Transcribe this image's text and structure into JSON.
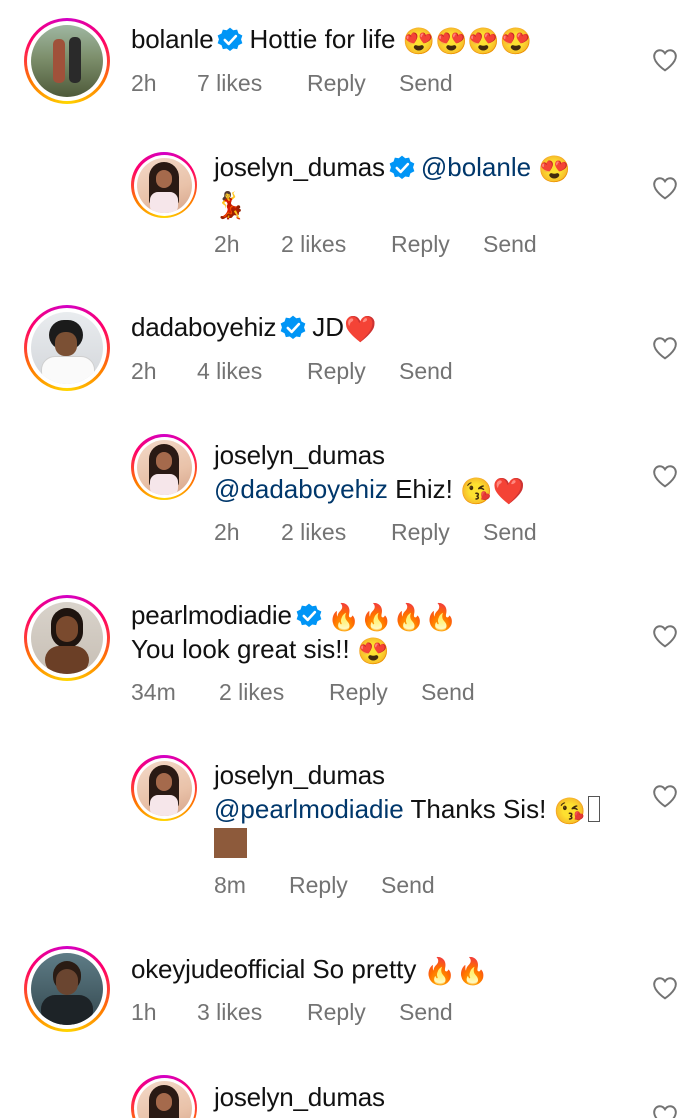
{
  "comments": [
    {
      "username": "bolanle",
      "verified": true,
      "text": "Hottie for life",
      "emoji": "😍😍😍😍",
      "time": "2h",
      "likes": "7 likes",
      "reply": "Reply",
      "send": "Send"
    },
    {
      "username": "joselyn_dumas",
      "verified": true,
      "mention": "@bolanle",
      "emoji": "😍",
      "emoji2": "💃",
      "time": "2h",
      "likes": "2 likes",
      "reply": "Reply",
      "send": "Send"
    },
    {
      "username": "dadaboyehiz",
      "verified": true,
      "text": "JD",
      "emoji": "❤️",
      "time": "2h",
      "likes": "4 likes",
      "reply": "Reply",
      "send": "Send"
    },
    {
      "username": "joselyn_dumas",
      "verified": false,
      "mention": "@dadaboyehiz",
      "text": "Ehiz!",
      "emoji": "😘❤️",
      "time": "2h",
      "likes": "2 likes",
      "reply": "Reply",
      "send": "Send"
    },
    {
      "username": "pearlmodiadie",
      "verified": true,
      "emoji": "🔥🔥🔥🔥",
      "text": "You look great sis!!",
      "emoji2": "😍",
      "time": "34m",
      "likes": "2 likes",
      "reply": "Reply",
      "send": "Send"
    },
    {
      "username": "joselyn_dumas",
      "verified": false,
      "mention": "@pearlmodiadie",
      "text": "Thanks Sis!",
      "emoji": "😘",
      "time": "8m",
      "reply": "Reply",
      "send": "Send"
    },
    {
      "username": "okeyjudeofficial",
      "verified": false,
      "text": "So pretty",
      "emoji": "🔥🔥",
      "time": "1h",
      "likes": "3 likes",
      "reply": "Reply",
      "send": "Send"
    },
    {
      "username": "joselyn_dumas",
      "verified": false
    }
  ],
  "colors": {
    "meta": "#737373",
    "mention": "#00376b",
    "verified": "#0095f6"
  },
  "icons": {
    "like": "heart-outline-icon",
    "verified": "verified-badge-icon"
  }
}
